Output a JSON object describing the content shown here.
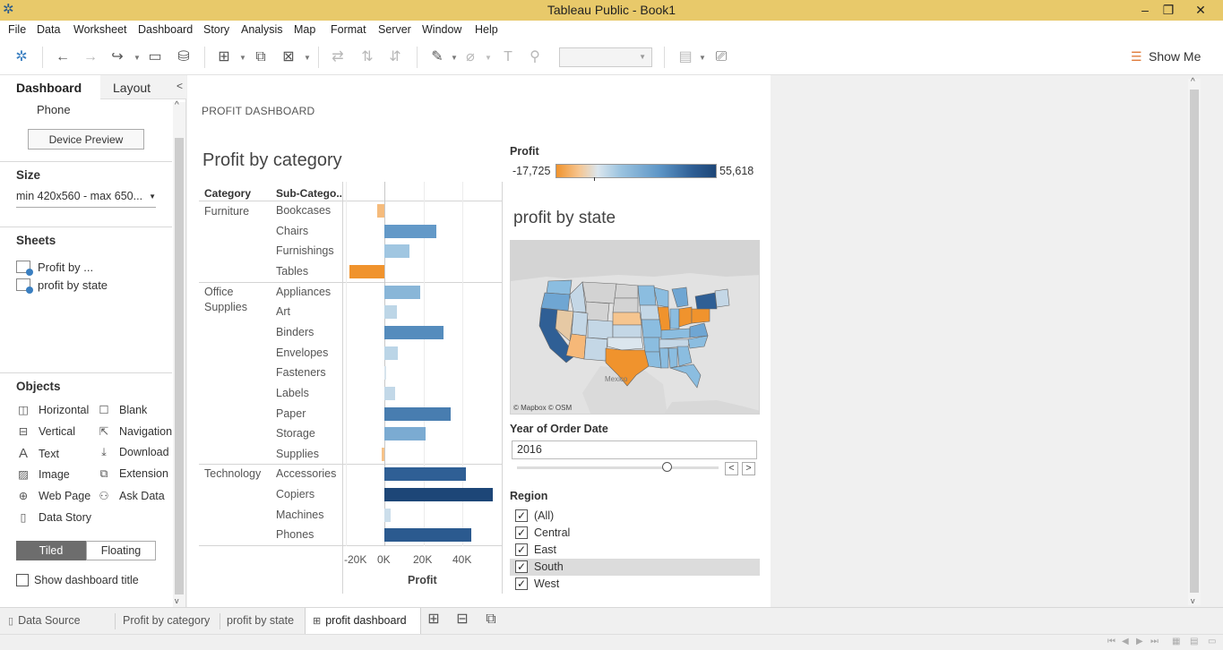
{
  "window": {
    "title": "Tableau Public - Book1"
  },
  "menu": [
    "File",
    "Data",
    "Worksheet",
    "Dashboard",
    "Story",
    "Analysis",
    "Map",
    "Format",
    "Server",
    "Window",
    "Help"
  ],
  "toolbar": {
    "show_me": "Show Me"
  },
  "left_pane": {
    "tabs": {
      "dashboard": "Dashboard",
      "layout": "Layout"
    },
    "device": {
      "current": "Phone",
      "preview_button": "Device Preview"
    },
    "size": {
      "title": "Size",
      "value": "min 420x560 - max 650..."
    },
    "sheets": {
      "title": "Sheets",
      "items": [
        "Profit by ...",
        "profit by state"
      ]
    },
    "objects": {
      "title": "Objects",
      "items": [
        "Horizontal",
        "Blank",
        "Vertical",
        "Navigation",
        "Text",
        "Download",
        "Image",
        "Extension",
        "Web Page",
        "Ask Data",
        "Data Story"
      ]
    },
    "layout_mode": {
      "tiled": "Tiled",
      "floating": "Floating"
    },
    "show_title": "Show dashboard title"
  },
  "dashboard": {
    "title": "PROFIT DASHBOARD",
    "chart_title": "Profit by category",
    "map_title": "profit by state",
    "legend": {
      "title": "Profit",
      "min": "-17,725",
      "max": "55,618"
    },
    "map_credit": "© Mapbox © OSM",
    "map_label": "Mexico",
    "year_filter": {
      "title": "Year of Order Date",
      "value": "2016"
    },
    "region_filter": {
      "title": "Region",
      "items": [
        {
          "label": "(All)",
          "checked": true
        },
        {
          "label": "Central",
          "checked": true
        },
        {
          "label": "East",
          "checked": true
        },
        {
          "label": "South",
          "checked": true
        },
        {
          "label": "West",
          "checked": true
        }
      ]
    }
  },
  "chart_data": {
    "type": "bar",
    "orientation": "horizontal",
    "title": "Profit by category",
    "xlabel": "Profit",
    "column_headers": [
      "Category",
      "Sub-Catego.."
    ],
    "xlim": [
      -20000,
      60000
    ],
    "x_ticks": [
      "-20K",
      "0K",
      "20K",
      "40K"
    ],
    "color_range": [
      -17725,
      55618
    ],
    "categories": [
      {
        "label": "Furniture",
        "items": [
          {
            "name": "Bookcases",
            "value": -3473
          },
          {
            "name": "Chairs",
            "value": 26590
          },
          {
            "name": "Furnishings",
            "value": 13059
          },
          {
            "name": "Tables",
            "value": -17725
          }
        ]
      },
      {
        "label": "Office\nSupplies",
        "items": [
          {
            "name": "Appliances",
            "value": 18138
          },
          {
            "name": "Art",
            "value": 6528
          },
          {
            "name": "Binders",
            "value": 30222
          },
          {
            "name": "Envelopes",
            "value": 6964
          },
          {
            "name": "Fasteners",
            "value": 950
          },
          {
            "name": "Labels",
            "value": 5546
          },
          {
            "name": "Paper",
            "value": 34054
          },
          {
            "name": "Storage",
            "value": 21279
          },
          {
            "name": "Supplies",
            "value": -1189
          }
        ]
      },
      {
        "label": "Technology",
        "items": [
          {
            "name": "Accessories",
            "value": 41937
          },
          {
            "name": "Copiers",
            "value": 55618
          },
          {
            "name": "Machines",
            "value": 3385
          },
          {
            "name": "Phones",
            "value": 44516
          }
        ]
      }
    ]
  },
  "bottom_tabs": {
    "data_source": "Data Source",
    "sheet1": "Profit by category",
    "sheet2": "profit by state",
    "dashboard": "profit dashboard"
  }
}
